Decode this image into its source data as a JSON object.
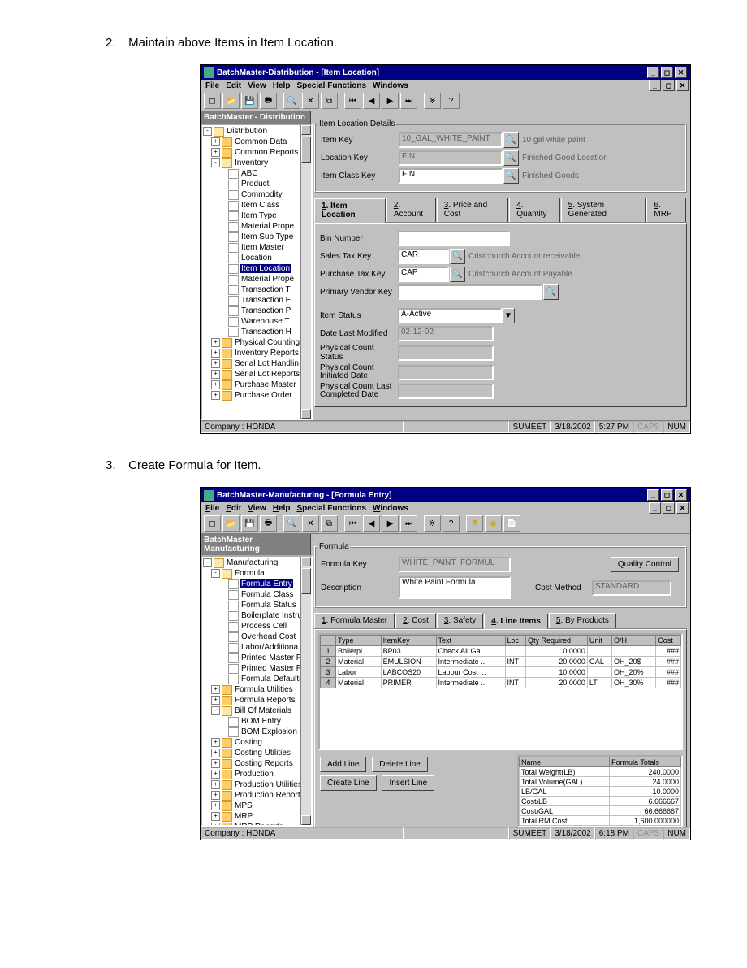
{
  "steps": {
    "s2": "Maintain above Items in Item Location.",
    "s3": "Create Formula for Item."
  },
  "win1": {
    "title": "BatchMaster-Distribution - [Item Location]",
    "menus": [
      "File",
      "Edit",
      "View",
      "Help",
      "Special Functions",
      "Windows"
    ],
    "sidehdr": "BatchMaster - Distribution",
    "tree": [
      {
        "t": "Distribution",
        "i": "fold open",
        "d": 0,
        "exp": "-"
      },
      {
        "t": "Common Data",
        "i": "fold",
        "d": 1,
        "exp": "+"
      },
      {
        "t": "Common Reports",
        "i": "fold",
        "d": 1,
        "exp": "+"
      },
      {
        "t": "Inventory",
        "i": "fold open",
        "d": 1,
        "exp": "-"
      },
      {
        "t": "ABC",
        "i": "doc",
        "d": 2
      },
      {
        "t": "Product",
        "i": "doc",
        "d": 2
      },
      {
        "t": "Commodity",
        "i": "doc",
        "d": 2
      },
      {
        "t": "Item Class",
        "i": "doc",
        "d": 2
      },
      {
        "t": "Item Type",
        "i": "doc",
        "d": 2
      },
      {
        "t": "Material Prope",
        "i": "doc",
        "d": 2
      },
      {
        "t": "Item Sub Type",
        "i": "doc",
        "d": 2
      },
      {
        "t": "Item Master",
        "i": "doc",
        "d": 2
      },
      {
        "t": "Location",
        "i": "doc",
        "d": 2
      },
      {
        "t": "Item Location",
        "i": "doc",
        "d": 2,
        "sel": true
      },
      {
        "t": "Material Prope",
        "i": "doc",
        "d": 2
      },
      {
        "t": "Transaction T",
        "i": "doc",
        "d": 2
      },
      {
        "t": "Transaction E",
        "i": "doc",
        "d": 2
      },
      {
        "t": "Transaction P",
        "i": "doc",
        "d": 2
      },
      {
        "t": "Warehouse T",
        "i": "doc",
        "d": 2
      },
      {
        "t": "Transaction H",
        "i": "doc",
        "d": 2
      },
      {
        "t": "Physical Counting",
        "i": "fold",
        "d": 1,
        "exp": "+"
      },
      {
        "t": "Inventory Reports",
        "i": "fold",
        "d": 1,
        "exp": "+"
      },
      {
        "t": "Serial Lot Handlin",
        "i": "fold",
        "d": 1,
        "exp": "+"
      },
      {
        "t": "Serial Lot Reports",
        "i": "fold",
        "d": 1,
        "exp": "+"
      },
      {
        "t": "Purchase Master",
        "i": "fold",
        "d": 1,
        "exp": "+"
      },
      {
        "t": "Purchase Order",
        "i": "fold",
        "d": 1,
        "exp": "+"
      }
    ],
    "group": "Item Location Details",
    "fields": {
      "itemkey": {
        "lbl": "Item Key",
        "val": "10_GAL_WHITE_PAINT",
        "desc": "10 gal white paint"
      },
      "lockey": {
        "lbl": "Location Key",
        "val": "FIN",
        "desc": "Finished Good Location"
      },
      "classkey": {
        "lbl": "Item Class Key",
        "val": "FIN",
        "desc": "Finished Goods"
      }
    },
    "tabs": [
      "1. Item Location",
      "2. Account",
      "3. Price and Cost",
      "4. Quantity",
      "5. System Generated",
      "6. MRP"
    ],
    "tabfields": {
      "bin": {
        "lbl": "Bin Number",
        "val": ""
      },
      "stax": {
        "lbl": "Sales Tax Key",
        "val": "CAR",
        "desc": "Cristchurch Account receivable"
      },
      "ptax": {
        "lbl": "Purchase Tax Key",
        "val": "CAP",
        "desc": "Cristchurch Account Payable"
      },
      "vendor": {
        "lbl": "Primary Vendor Key",
        "val": ""
      },
      "status": {
        "lbl": "Item Status",
        "val": "A-Active"
      },
      "modified": {
        "lbl": "Date Last Modified",
        "val": "02-12-02"
      },
      "pcstatus": {
        "lbl": "Physical Count Status",
        "val": ""
      },
      "pcinit": {
        "lbl": "Physical Count Initiated Date",
        "val": ""
      },
      "pclast": {
        "lbl": "Physical Count Last Completed Date",
        "val": ""
      }
    },
    "status": {
      "company": "Company : HONDA",
      "user": "SUMEET",
      "date": "3/18/2002",
      "time": "5:27 PM",
      "caps": "CAPS",
      "num": "NUM"
    }
  },
  "win2": {
    "title": "BatchMaster-Manufacturing - [Formula Entry]",
    "menus": [
      "File",
      "Edit",
      "View",
      "Help",
      "Special Functions",
      "Windows"
    ],
    "sidehdr": "BatchMaster - Manufacturing",
    "tree": [
      {
        "t": "Manufacturing",
        "i": "fold open",
        "d": 0,
        "exp": "-"
      },
      {
        "t": "Formula",
        "i": "fold open",
        "d": 1,
        "exp": "-"
      },
      {
        "t": "Formula Entry",
        "i": "doc",
        "d": 2,
        "sel": true
      },
      {
        "t": "Formula Class",
        "i": "doc",
        "d": 2
      },
      {
        "t": "Formula Status",
        "i": "doc",
        "d": 2
      },
      {
        "t": "Boilerplate Instru",
        "i": "doc",
        "d": 2
      },
      {
        "t": "Process Cell",
        "i": "doc",
        "d": 2
      },
      {
        "t": "Overhead Cost",
        "i": "doc",
        "d": 2
      },
      {
        "t": "Labor/Additiona",
        "i": "doc",
        "d": 2
      },
      {
        "t": "Printed Master F",
        "i": "doc",
        "d": 2
      },
      {
        "t": "Printed Master F",
        "i": "doc",
        "d": 2
      },
      {
        "t": "Formula Defaults",
        "i": "doc",
        "d": 2
      },
      {
        "t": "Formula Utilities",
        "i": "fold",
        "d": 1,
        "exp": "+"
      },
      {
        "t": "Formula Reports",
        "i": "fold",
        "d": 1,
        "exp": "+"
      },
      {
        "t": "Bill Of Materials",
        "i": "fold open",
        "d": 1,
        "exp": "-"
      },
      {
        "t": "BOM Entry",
        "i": "doc",
        "d": 2
      },
      {
        "t": "BOM Explosion",
        "i": "doc",
        "d": 2
      },
      {
        "t": "Costing",
        "i": "fold",
        "d": 1,
        "exp": "+"
      },
      {
        "t": "Costing Utilities",
        "i": "fold",
        "d": 1,
        "exp": "+"
      },
      {
        "t": "Costing Reports",
        "i": "fold",
        "d": 1,
        "exp": "+"
      },
      {
        "t": "Production",
        "i": "fold",
        "d": 1,
        "exp": "+"
      },
      {
        "t": "Production Utilities",
        "i": "fold",
        "d": 1,
        "exp": "+"
      },
      {
        "t": "Production Reports",
        "i": "fold",
        "d": 1,
        "exp": "+"
      },
      {
        "t": "MPS",
        "i": "fold",
        "d": 1,
        "exp": "+"
      },
      {
        "t": "MRP",
        "i": "fold",
        "d": 1,
        "exp": "+"
      },
      {
        "t": "MRP Reports",
        "i": "fold",
        "d": 1,
        "exp": "+"
      }
    ],
    "group": "Formula",
    "fields": {
      "fkey": {
        "lbl": "Formula Key",
        "val": "WHITE_PAINT_FORMUL"
      },
      "desc": {
        "lbl": "Description",
        "val": "White Paint Formula"
      },
      "costmethod": {
        "lbl": "Cost Method",
        "val": "STANDARD"
      }
    },
    "qc": "Quality Control",
    "tabs": [
      "1. Formula Master",
      "2. Cost",
      "3. Safety",
      "4. Line Items",
      "5. By Products"
    ],
    "gridhdr": [
      "",
      "Type",
      "ItemKey",
      "Text",
      "Loc",
      "Qty Required",
      "Unit",
      "O/H",
      "Cost"
    ],
    "gridrows": [
      [
        "1",
        "Boilerpl...",
        "BP03",
        "Check All Ga...",
        "",
        "0.0000",
        "",
        "",
        "###"
      ],
      [
        "2",
        "Material",
        "EMULSION",
        "Intermediate ...",
        "INT",
        "20.0000",
        "GAL",
        "OH_20$",
        "###"
      ],
      [
        "3",
        "Labor",
        "LABCOS20",
        "Labour Cost ...",
        "",
        "10.0000",
        "",
        "OH_20%",
        "###"
      ],
      [
        "4",
        "Material",
        "PRIMER",
        "Intermediate ...",
        "INT",
        "20.0000",
        "LT",
        "OH_30%",
        "###"
      ]
    ],
    "btns": {
      "add": "Add Line",
      "del": "Delete Line",
      "create": "Create Line",
      "insert": "Insert Line"
    },
    "tothdr": [
      "Name",
      "Formula Totals"
    ],
    "totals": [
      [
        "Total Weight(LB)",
        "240.0000"
      ],
      [
        "Total Volume(GAL)",
        "24.0000"
      ],
      [
        "LB/GAL",
        "10.0000"
      ],
      [
        "Cost/LB",
        "6.666667"
      ],
      [
        "Cost/GAL",
        "66.666667"
      ],
      [
        "Total RM Cost",
        "1,600.000000"
      ]
    ],
    "status": {
      "company": "Company : HONDA",
      "user": "SUMEET",
      "date": "3/18/2002",
      "time": "6:18 PM",
      "caps": "CAPS",
      "num": "NUM"
    }
  }
}
